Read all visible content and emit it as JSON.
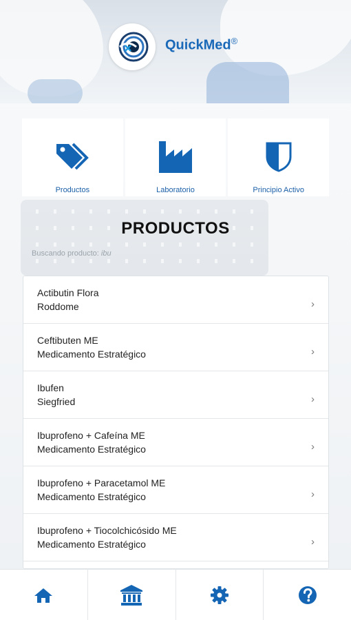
{
  "app": {
    "brand": "QuickMed",
    "brand_mark": "®"
  },
  "categories": [
    {
      "label": "Productos",
      "icon": "tags-icon"
    },
    {
      "label": "Laboratorio",
      "icon": "factory-icon"
    },
    {
      "label": "Principio Activo",
      "icon": "shield-icon"
    }
  ],
  "section_title": "PRODUCTOS",
  "search": {
    "prefix": "Buscando producto:",
    "query": "ibu"
  },
  "products": [
    {
      "name": "Actibutin Flora",
      "lab": "Roddome"
    },
    {
      "name": "Ceftibuten ME",
      "lab": "Medicamento Estratégico"
    },
    {
      "name": "Ibufen",
      "lab": "Siegfried"
    },
    {
      "name": "Ibuprofeno + Cafeína ME",
      "lab": "Medicamento Estratégico"
    },
    {
      "name": "Ibuprofeno + Paracetamol ME",
      "lab": "Medicamento Estratégico"
    },
    {
      "name": "Ibuprofeno + Tiocolchicósido ME",
      "lab": "Medicamento Estratégico"
    }
  ],
  "chevron": "›",
  "tabbar": [
    {
      "icon": "home-icon"
    },
    {
      "icon": "bank-icon"
    },
    {
      "icon": "gear-icon"
    },
    {
      "icon": "help-icon"
    }
  ],
  "colors": {
    "accent": "#1a68b8",
    "icon_blue": "#1565b5"
  }
}
